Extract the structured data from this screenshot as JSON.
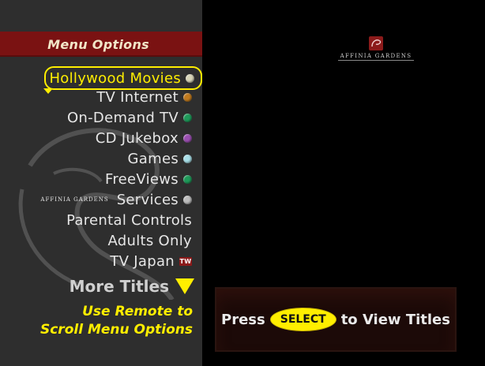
{
  "menu": {
    "title": "Menu Options",
    "items": [
      {
        "label": "Hollywood Movies",
        "bullet_color": "#d8d5b8",
        "selected": true
      },
      {
        "label": "TV Internet",
        "bullet_color": "#c07a1e"
      },
      {
        "label": "On-Demand TV",
        "bullet_color": "#1f9a5a"
      },
      {
        "label": "CD Jukebox",
        "bullet_color": "#9a4fb0"
      },
      {
        "label": "Games",
        "bullet_color": "#a8dfe8"
      },
      {
        "label": "FreeViews",
        "bullet_color": "#1f9a5a"
      },
      {
        "label": "Services",
        "bullet_color": "#bdbdbd",
        "brand_prefix": "AFFINIA GARDENS"
      },
      {
        "label": "Parental Controls"
      },
      {
        "label": "Adults Only"
      },
      {
        "label": "TV Japan",
        "badge": "TW"
      }
    ],
    "more_titles_label": "More Titles",
    "scroll_hint_line1": "Use Remote to",
    "scroll_hint_line2": "Scroll Menu Options"
  },
  "brand": {
    "name": "AFFINIA GARDENS"
  },
  "banner": {
    "press": "Press",
    "select_button": "SELECT",
    "tail": "to View Titles"
  },
  "colors": {
    "menu_bg": "#2e2e2e",
    "header_bg": "#7a1212",
    "highlight": "#ffee00"
  }
}
